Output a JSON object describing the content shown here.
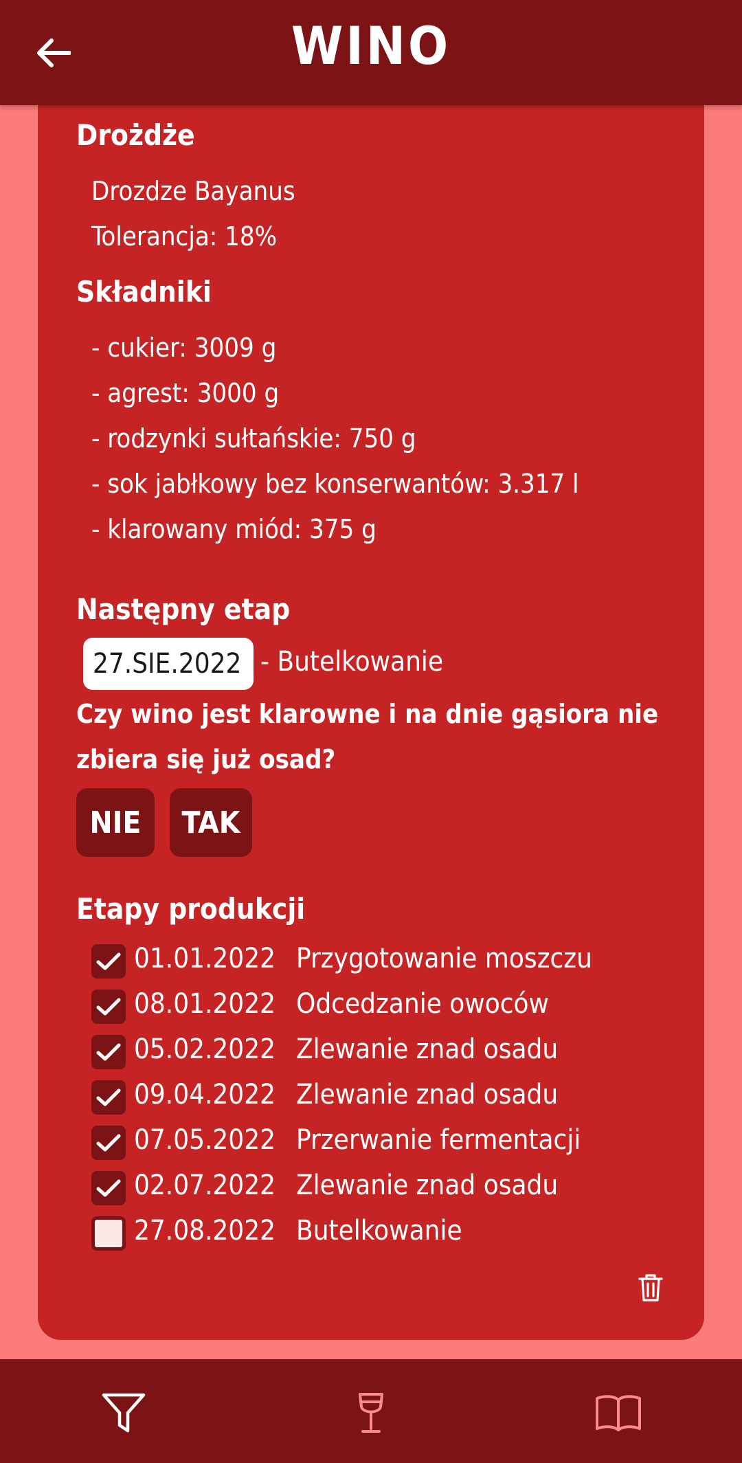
{
  "header": {
    "title": "WINO"
  },
  "yeast": {
    "heading": "Drożdże",
    "name": "Drozdze Bayanus",
    "tolerance": "Tolerancja: 18%"
  },
  "ingredients": {
    "heading": "Składniki",
    "items": [
      "- cukier: 3009 g",
      "- agrest: 3000 g",
      "- rodzynki sułtańskie: 750 g",
      "- sok jabłkowy bez konserwantów: 3.317 l",
      "- klarowany miód: 375 g"
    ]
  },
  "next_step": {
    "heading": "Następny etap",
    "date": "27.SIE.2022",
    "label": "- Butelkowanie",
    "question": "Czy wino jest klarowne i na dnie gąsiora nie zbiera się już osad?",
    "no_label": "NIE",
    "yes_label": "TAK"
  },
  "stages": {
    "heading": "Etapy produkcji",
    "items": [
      {
        "date": "01.01.2022",
        "name": "Przygotowanie moszczu",
        "done": true
      },
      {
        "date": "08.01.2022",
        "name": "Odcedzanie owoców",
        "done": true
      },
      {
        "date": "05.02.2022",
        "name": "Zlewanie znad osadu",
        "done": true
      },
      {
        "date": "09.04.2022",
        "name": "Zlewanie znad osadu",
        "done": true
      },
      {
        "date": "07.05.2022",
        "name": "Przerwanie fermentacji",
        "done": true
      },
      {
        "date": "02.07.2022",
        "name": "Zlewanie znad osadu",
        "done": true
      },
      {
        "date": "27.08.2022",
        "name": "Butelkowanie",
        "done": false
      }
    ]
  },
  "icons": {
    "back": "arrow-back-icon",
    "trash": "trash-icon",
    "filter": "filter-icon",
    "wine": "wine-glass-icon",
    "book": "book-icon"
  },
  "colors": {
    "header": "#7c1416",
    "card": "#c62424",
    "background": "#fb7a7a",
    "nav_icon": "#ff8a8a"
  }
}
